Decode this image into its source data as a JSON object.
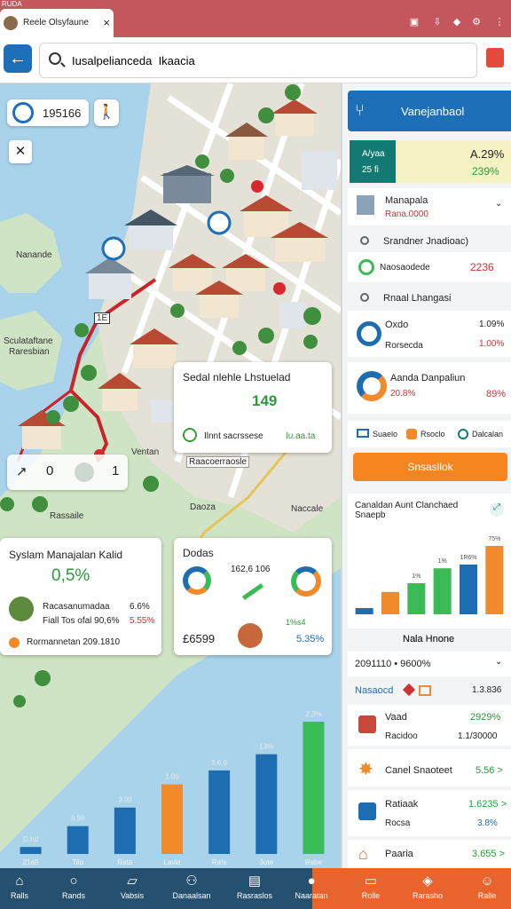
{
  "browser": {
    "corner_text": "RUDA",
    "tab_title": "Reele Olsyfaune",
    "search_value": "Iusalpelianceda  Ikaacia"
  },
  "map": {
    "chip_value": "195166",
    "labels": [
      "Nanande",
      "Sculataftane",
      "Raresbian",
      "Ventan",
      "Rassaile",
      "Daoza",
      "Naccale"
    ],
    "road_sign": "1E",
    "popup": {
      "title": "Sedal nlehle Lhstuelad",
      "value": "149",
      "row_label": "Ilnnt sacrssese",
      "row_value": "Iu.aa.ta",
      "tag": "Raacoerraosle"
    },
    "navtool": {
      "a": "1",
      "b": "0",
      "c": "1"
    }
  },
  "card1": {
    "title": "Syslam Manajalan Kalid",
    "percent": "0,5%",
    "row1_label": "Racasanumadaa",
    "row1_label2": "Fiall Tos ofal 90,6%",
    "row1_value": "6.6%",
    "row1_value2": "5.55%",
    "footer": "Rormannetan 209.1810"
  },
  "card2": {
    "title": "Dodas",
    "center_value": "162,6 106",
    "bottom_value": "£6599",
    "bottom_percent": "5.35%",
    "small_value": "1%s4"
  },
  "bottom_chart": {
    "chart_data": {
      "type": "bar",
      "categories": [
        "",
        "",
        "",
        "",
        "",
        "",
        ""
      ],
      "values": [
        3,
        12,
        20,
        30,
        36,
        43,
        57
      ],
      "data_labels": [
        "D.hd",
        "3.96",
        "3.00",
        "1.00",
        "3.6.9",
        "13%",
        "2.3%"
      ],
      "x_labels": [
        "21a9",
        "Tilo",
        "Rata",
        "Lavia",
        "Ra!s",
        "3ote",
        "Rabe"
      ],
      "colors": [
        "#1d6db0",
        "#1d6db0",
        "#1d6db0",
        "#f08a2a",
        "#1d6db0",
        "#1d6db0",
        "#3bbb55"
      ],
      "ylim": [
        0,
        62
      ]
    }
  },
  "panel": {
    "header": "Vanejanbaol",
    "stat_left_top": "A/yaa",
    "stat_left_bot": "25 fi",
    "stat_right_top": "A.29%",
    "stat_right_bot": "239%",
    "mana_title": "Manapala",
    "mana_sub": "Rana.0000",
    "section1": "Srandner Jnadioac)",
    "section1_item": "Naosaodede",
    "section1_value": "2236",
    "section2": "Rnaal Lhangasi",
    "item1_title": "Oxdo",
    "item1_sub": "Rorsecda",
    "item1_value": "1.09%",
    "item1_value2": "1.00%",
    "item2_title": "Aanda Danpaliun",
    "item2_sub": "20.8%",
    "item2_value": "89%",
    "quick": [
      "Suaelo",
      "Rsoclo",
      "Dalcalan"
    ],
    "button": "Snsasllok",
    "chart_title": "Canaldan Aunt Clanchaed Snaepb",
    "chart_caption": "Nala Hnone",
    "chart": {
      "chart_data": {
        "type": "bar",
        "categories": [
          "",
          "",
          "",
          "",
          "",
          ""
        ],
        "values": [
          5,
          18,
          25,
          37,
          40,
          55
        ],
        "data_labels": [
          "",
          "",
          "1%",
          "1%",
          "1R6%",
          "75%"
        ],
        "colors": [
          "#1d6db0",
          "#f08a2a",
          "#3bbb55",
          "#3bbb55",
          "#1d6db0",
          "#f08a2a"
        ],
        "ylim": [
          0,
          60
        ]
      }
    },
    "row_date": "2091110 • 9600%",
    "list_header": "Nasaocd",
    "list_header_value": "1.3.836",
    "items": [
      {
        "title": "Vaad",
        "sub": "Racidoo",
        "value": "2929%",
        "value2": "1.1/30000"
      },
      {
        "title": "Canel Snaoteet",
        "sub": "",
        "value": "5.56 >",
        "value2": ""
      },
      {
        "title": "Ratiaak",
        "sub": "Rocsa",
        "value": "1.6235 >",
        "value2": "3.8%"
      },
      {
        "title": "Paaria",
        "sub": "",
        "value": "3.655 >",
        "value2": ""
      }
    ]
  },
  "bottom_nav": [
    "Ralls",
    "Rands",
    "Vabsis",
    "Danaalsan",
    "Rasraslos",
    "Naaratan",
    "Rolle",
    "Rarasho",
    "Ralle"
  ]
}
